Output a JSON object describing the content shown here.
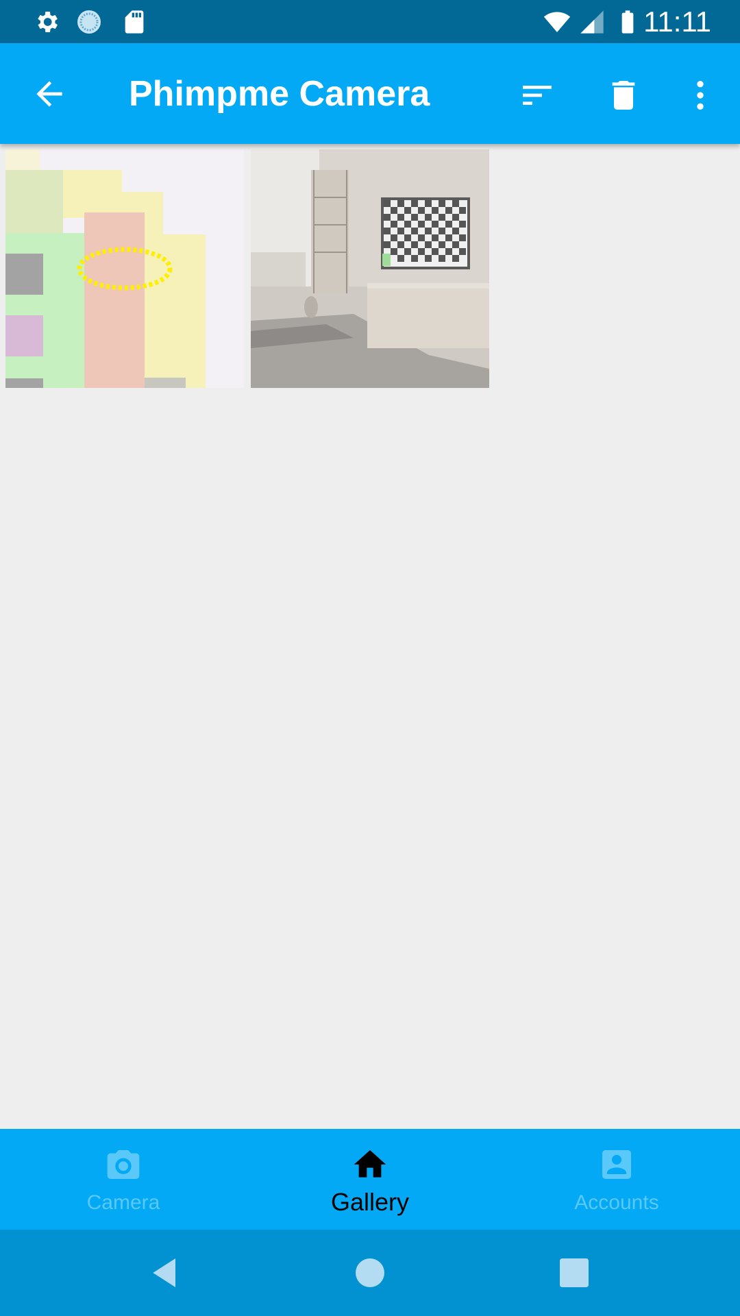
{
  "status_bar": {
    "time": "11:11",
    "left_icons": [
      "settings-icon",
      "sync-icon",
      "sd-card-icon"
    ],
    "right_icons": [
      "wifi-icon",
      "signal-icon",
      "battery-icon"
    ]
  },
  "app_bar": {
    "title": "Phimpme Camera",
    "actions": [
      "sort-icon",
      "delete-icon",
      "more-vert-icon"
    ]
  },
  "gallery": {
    "items": [
      {
        "name": "colorful-blocks-image"
      },
      {
        "name": "living-room-image"
      }
    ]
  },
  "bottom_nav": {
    "items": [
      {
        "label": "Camera",
        "icon": "camera-icon",
        "active": false
      },
      {
        "label": "Gallery",
        "icon": "home-icon",
        "active": true
      },
      {
        "label": "Accounts",
        "icon": "account-icon",
        "active": false
      }
    ]
  },
  "colors": {
    "status_bar": "#026996",
    "app_bar": "#03a9f4",
    "background": "#eeeeee",
    "nav_inactive": "#5ac8f8",
    "system_nav": "#0291d1"
  }
}
